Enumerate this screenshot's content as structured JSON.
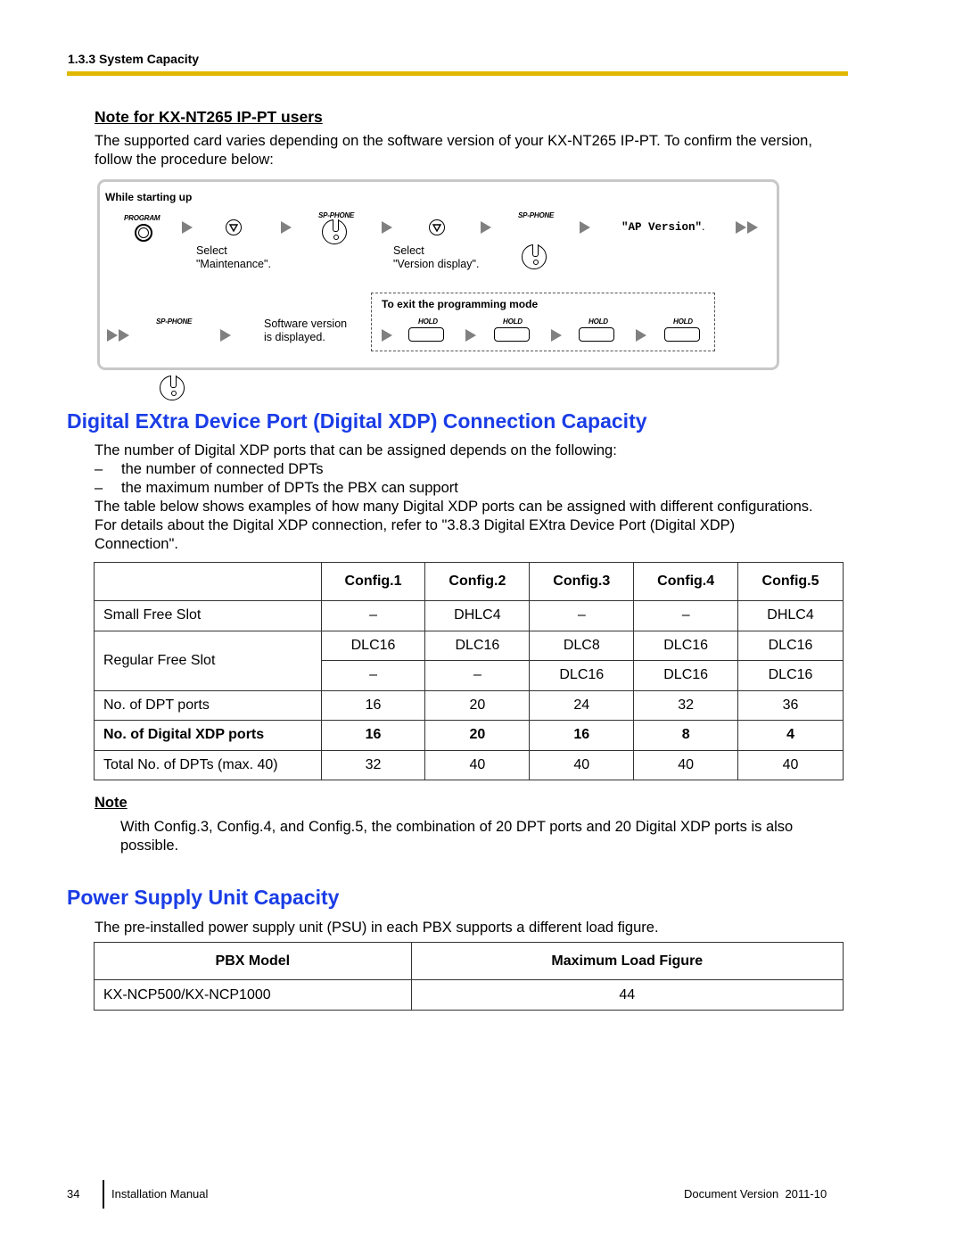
{
  "header": {
    "section": "1.3.3 System Capacity",
    "accent_color": "#e0b800"
  },
  "note_kx": {
    "title": "Note for KX-NT265 IP-PT users",
    "body": "The supported card varies depending on the software version of your KX-NT265 IP-PT. To confirm the version, follow the procedure below:"
  },
  "procedure": {
    "title": "While starting up",
    "program_label": "PROGRAM",
    "sp_phone_label": "SP-PHONE",
    "step1_caption_line1": "Select",
    "step1_caption_line2": "\"Maintenance\".",
    "step2_caption_line1": "Select",
    "step2_caption_line2": "\"Version display\".",
    "ap_version": "\"AP Version\"",
    "ap_version_period": ".",
    "software_line1": "Software version",
    "software_line2": "is displayed.",
    "exit_title": "To exit the programming mode",
    "hold_label": "HOLD"
  },
  "xdp_section": {
    "title": "Digital EXtra Device Port (Digital XDP) Connection Capacity",
    "title_color": "#1a3de6",
    "intro": "The number of Digital XDP ports that can be assigned depends on the following:",
    "bullets": [
      "the number of connected DPTs",
      "the maximum number of DPTs the PBX can support"
    ],
    "bullet_marker": "–",
    "para_line1": "The table below shows examples of how many Digital XDP ports can be assigned with different configurations.",
    "para_line2": "For details about the Digital XDP connection, refer to \"3.8.3  Digital EXtra Device Port (Digital XDP)",
    "para_line3": "Connection\"."
  },
  "config_table": {
    "headers": [
      "",
      "Config.1",
      "Config.2",
      "Config.3",
      "Config.4",
      "Config.5"
    ],
    "small_free_slot": {
      "label": "Small Free Slot",
      "values": [
        "–",
        "DHLC4",
        "–",
        "–",
        "DHLC4"
      ]
    },
    "regular_free_slot": {
      "label": "Regular Free Slot",
      "row1": [
        "DLC16",
        "DLC16",
        "DLC8",
        "DLC16",
        "DLC16"
      ],
      "row2": [
        "–",
        "–",
        "DLC16",
        "DLC16",
        "DLC16"
      ]
    },
    "dpt_ports": {
      "label": "No. of DPT ports",
      "values": [
        "16",
        "20",
        "24",
        "32",
        "36"
      ]
    },
    "xdp_ports": {
      "label": "No. of Digital XDP ports",
      "values": [
        "16",
        "20",
        "16",
        "8",
        "4"
      ]
    },
    "total_dpts": {
      "label": "Total No. of DPTs (max. 40)",
      "values": [
        "32",
        "40",
        "40",
        "40",
        "40"
      ]
    }
  },
  "note2": {
    "title": "Note",
    "text": "With Config.3, Config.4, and Config.5, the combination of 20 DPT ports and 20 Digital XDP ports is also possible."
  },
  "psu_section": {
    "title": "Power Supply Unit Capacity",
    "intro": "The pre-installed power supply unit (PSU) in each PBX supports a different load figure.",
    "headers": [
      "PBX Model",
      "Maximum Load Figure"
    ],
    "rows": [
      [
        "KX-NCP500/KX-NCP1000",
        "44"
      ]
    ]
  },
  "footer": {
    "page_number": "34",
    "manual": "Installation Manual",
    "doc_version": "Document Version  2011-10"
  }
}
